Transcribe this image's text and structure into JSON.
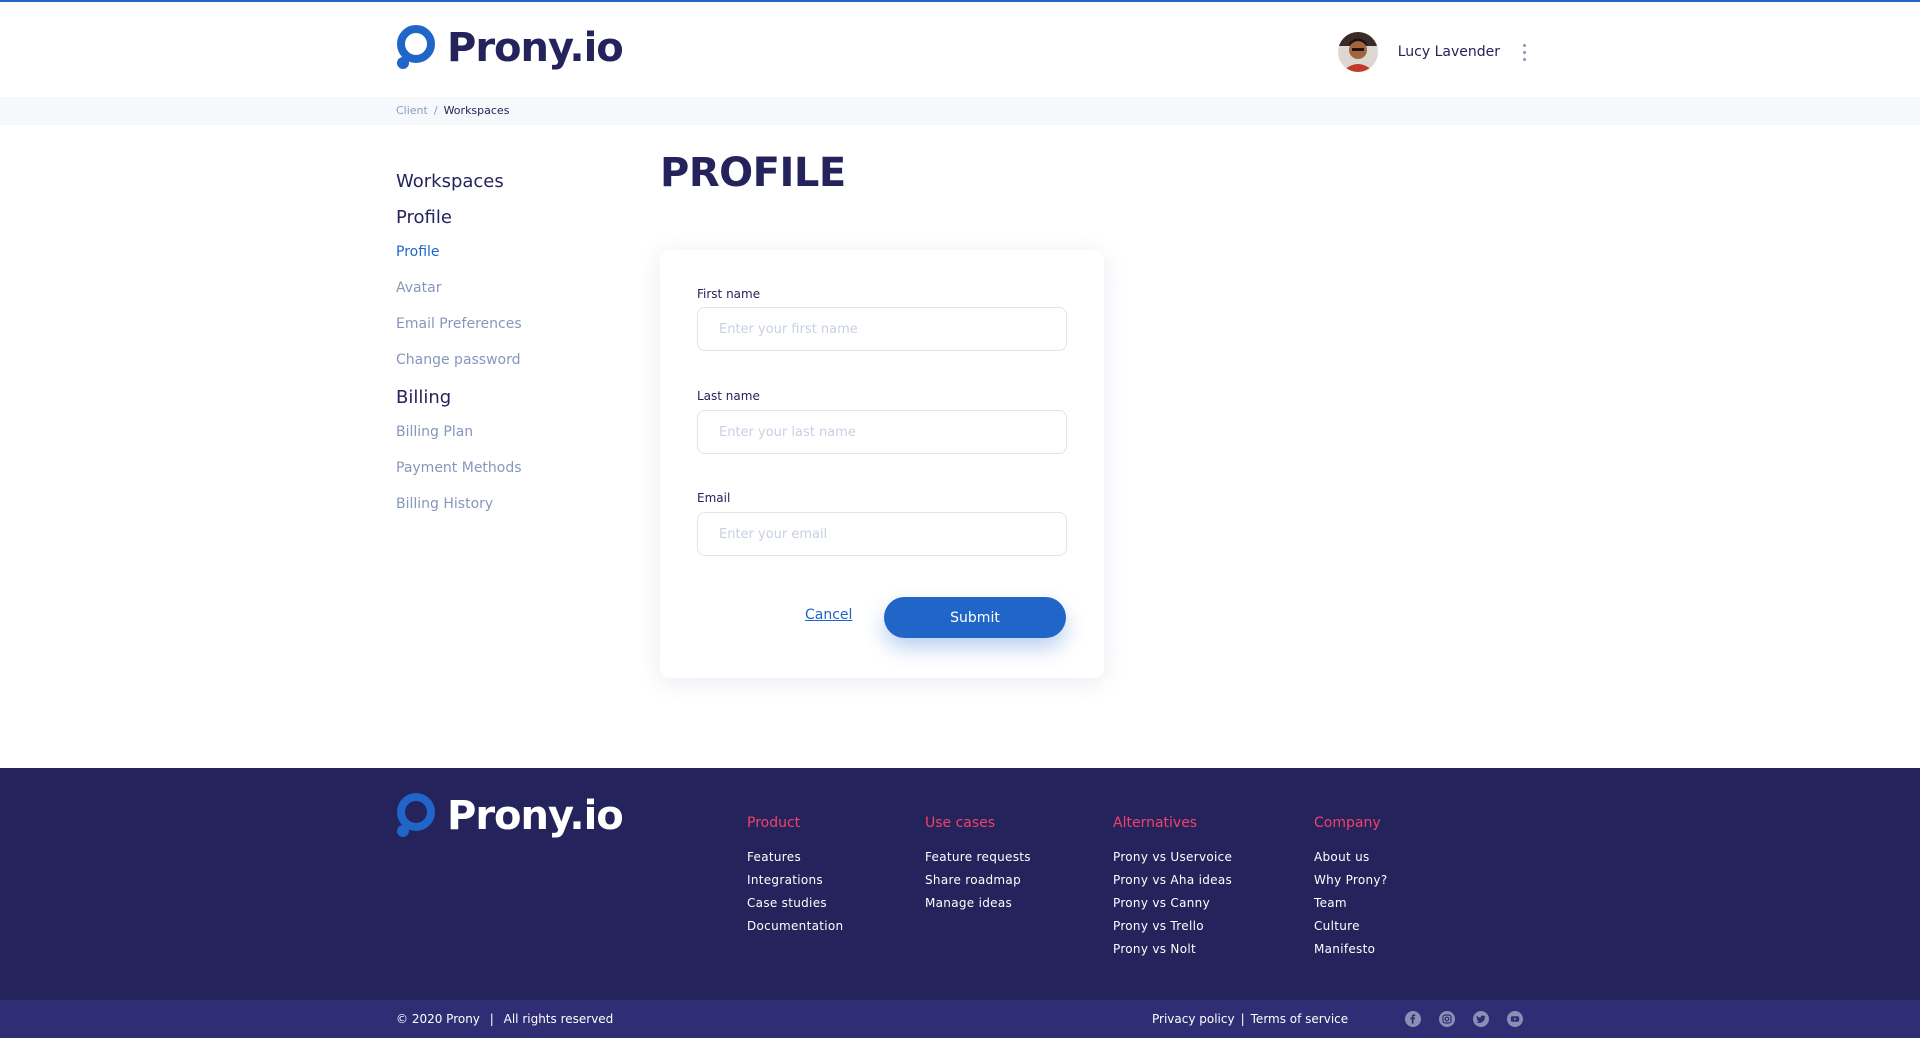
{
  "brand": {
    "name": "Prony.io",
    "accent": "#1f66c8",
    "dark": "#25235b",
    "footer_heading": "#f0426b"
  },
  "header": {
    "user_name": "Lucy Lavender",
    "avatar": "user-avatar",
    "menu_icon": "kebab-menu-icon"
  },
  "breadcrumb": {
    "items": [
      "Client",
      "Workspaces"
    ],
    "separator": "/"
  },
  "sidebar": {
    "workspaces": "Workspaces",
    "profile_heading": "Profile",
    "profile_items": [
      "Profile",
      "Avatar",
      "Email Preferences",
      "Change password"
    ],
    "billing_heading": "Billing",
    "billing_items": [
      "Billing Plan",
      "Payment Methods",
      "Billing History"
    ]
  },
  "main": {
    "title": "PROFILE",
    "form": {
      "first_name_label": "First name",
      "first_name_placeholder": "Enter your first name",
      "last_name_label": "Last name",
      "last_name_placeholder": "Enter your last name",
      "email_label": "Email",
      "email_placeholder": "Enter your email",
      "cancel": "Cancel",
      "submit": "Submit"
    }
  },
  "footer": {
    "columns": [
      {
        "title": "Product",
        "links": [
          "Features",
          "Integrations",
          "Case studies",
          "Documentation"
        ]
      },
      {
        "title": "Use cases",
        "links": [
          "Feature requests",
          "Share roadmap",
          "Manage ideas"
        ]
      },
      {
        "title": "Alternatives",
        "links": [
          "Prony vs Uservoice",
          "Prony vs Aha ideas",
          "Prony vs Canny",
          "Prony vs Trello",
          "Prony vs Nolt"
        ]
      },
      {
        "title": "Company",
        "links": [
          "About us",
          "Why Prony?",
          "Team",
          "Culture",
          "Manifesto"
        ]
      }
    ],
    "copyright": "© 2020 Prony",
    "rights": "All rights reserved",
    "privacy": "Privacy policy",
    "terms": "Terms of service",
    "divider": "|",
    "social_icons": [
      "facebook-icon",
      "instagram-icon",
      "twitter-icon",
      "youtube-icon"
    ]
  }
}
